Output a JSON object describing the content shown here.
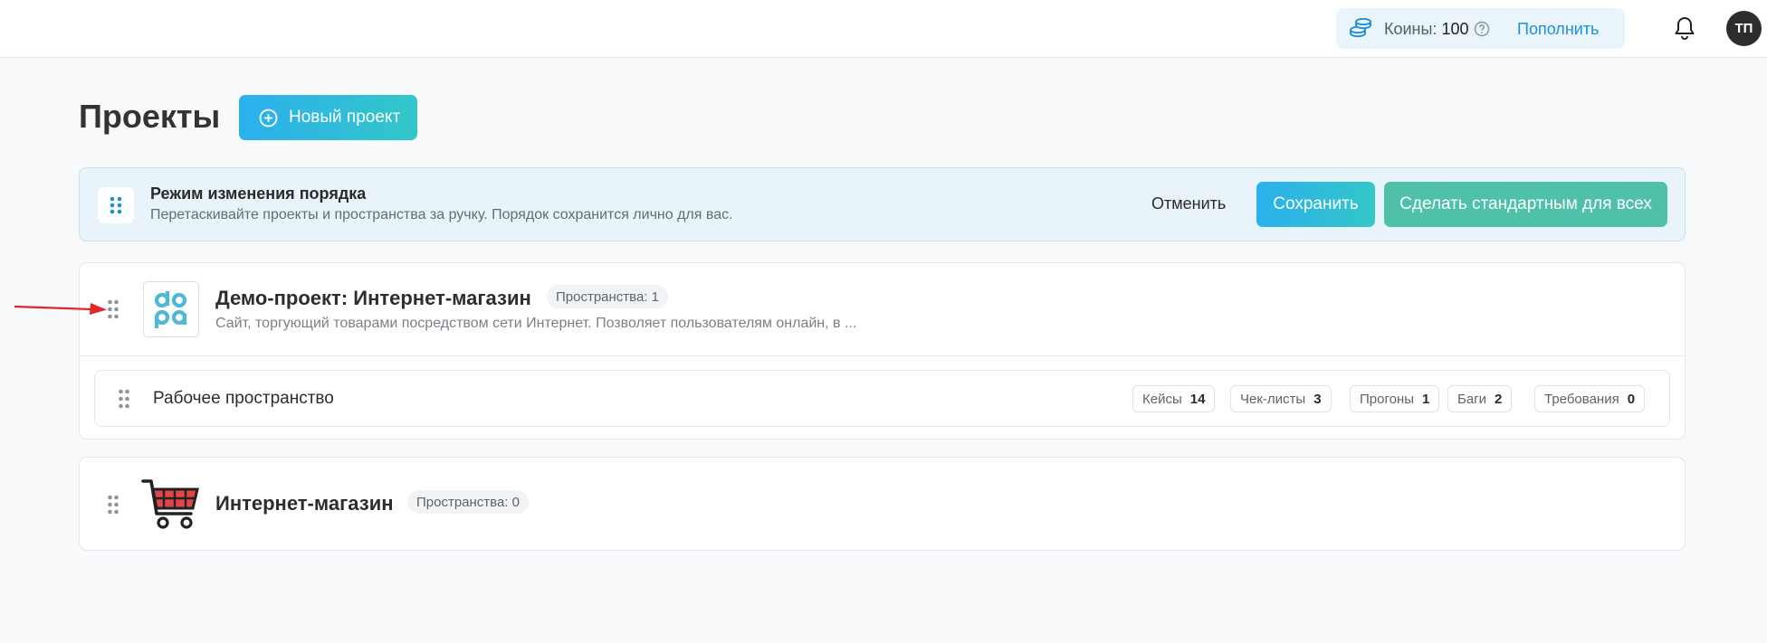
{
  "topbar": {
    "coins_label": "Коины:",
    "coins_value": "100",
    "topup_label": "Пополнить",
    "avatar_initials": "ТП",
    "accent_color": "#1f8fd6"
  },
  "page": {
    "title": "Проекты",
    "new_project_label": "Новый проект"
  },
  "banner": {
    "title": "Режим изменения порядка",
    "text": "Перетаскивайте проекты и пространства за ручку. Порядок сохранится лично для вас.",
    "cancel_label": "Отменить",
    "save_label": "Сохранить",
    "default_label": "Сделать стандартным для всех"
  },
  "projects": [
    {
      "name": "Демо-проект: Интернет-магазин",
      "spaces_badge": "Пространства: 1",
      "description": "Сайт, торгующий товарами посредством сети Интернет. Позволяет пользователям онлайн, в ...",
      "logo_icon": "doqa-logo-icon",
      "spaces": [
        {
          "name": "Рабочее пространство",
          "stats": [
            {
              "label": "Кейсы",
              "value": "14"
            },
            {
              "label": "Чек-листы",
              "value": "3"
            },
            {
              "label": "Прогоны",
              "value": "1"
            },
            {
              "label": "Баги",
              "value": "2"
            },
            {
              "label": "Требования",
              "value": "0"
            }
          ]
        }
      ]
    },
    {
      "name": "Интернет-магазин",
      "spaces_badge": "Пространства: 0",
      "logo_icon": "shopping-cart-icon"
    }
  ]
}
